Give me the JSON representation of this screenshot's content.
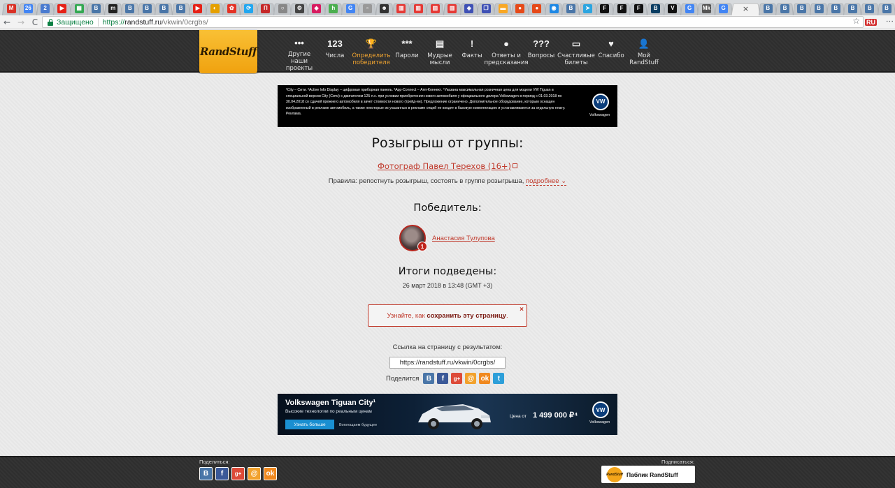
{
  "browser": {
    "tabs": [
      {
        "icon": "gmail-icon",
        "glyph": "M",
        "color": "#d93025"
      },
      {
        "icon": "calendar-icon",
        "glyph": "26",
        "color": "#4285f4"
      },
      {
        "icon": "two-icon",
        "glyph": "2",
        "color": "#4a7bd0"
      },
      {
        "icon": "youtube-icon",
        "glyph": "▶",
        "color": "#e62117"
      },
      {
        "icon": "grid-icon",
        "glyph": "▦",
        "color": "#34a853"
      },
      {
        "icon": "vk-icon",
        "glyph": "B",
        "color": "#4a76a8"
      },
      {
        "icon": "m-icon",
        "glyph": "m",
        "color": "#222"
      },
      {
        "icon": "vk-icon",
        "glyph": "B",
        "color": "#4a76a8"
      },
      {
        "icon": "vk-icon",
        "glyph": "B",
        "color": "#4a76a8"
      },
      {
        "icon": "vk-icon",
        "glyph": "B",
        "color": "#4a76a8"
      },
      {
        "icon": "vk-icon",
        "glyph": "B",
        "color": "#4a76a8"
      },
      {
        "icon": "youtube-icon",
        "glyph": "▶",
        "color": "#e62117"
      },
      {
        "icon": "weather-icon",
        "glyph": "◐",
        "color": "#e5a000"
      },
      {
        "icon": "aliexpress-icon",
        "glyph": "✿",
        "color": "#e43225"
      },
      {
        "icon": "refresh-icon",
        "glyph": "⟳",
        "color": "#22a7f0"
      },
      {
        "icon": "doc-icon",
        "glyph": "П",
        "color": "#c62828"
      },
      {
        "icon": "circle-icon",
        "glyph": "○",
        "color": "#888"
      },
      {
        "icon": "gear-icon",
        "glyph": "⚙",
        "color": "#444"
      },
      {
        "icon": "shield-icon",
        "glyph": "◆",
        "color": "#d81b60"
      },
      {
        "icon": "h-icon",
        "glyph": "h",
        "color": "#4caf50"
      },
      {
        "icon": "google-icon",
        "glyph": "G",
        "color": "#4285f4"
      },
      {
        "icon": "page-icon",
        "glyph": "▫",
        "color": "#999"
      },
      {
        "icon": "person-icon",
        "glyph": "☻",
        "color": "#333"
      },
      {
        "icon": "bars-icon",
        "glyph": "▥",
        "color": "#e53935"
      },
      {
        "icon": "bars-icon",
        "glyph": "▥",
        "color": "#e53935"
      },
      {
        "icon": "bars-icon",
        "glyph": "▥",
        "color": "#e53935"
      },
      {
        "icon": "bars-icon",
        "glyph": "▥",
        "color": "#e53935"
      },
      {
        "icon": "cube-icon",
        "glyph": "◈",
        "color": "#3f51b5"
      },
      {
        "icon": "copy-icon",
        "glyph": "❐",
        "color": "#3f51b5"
      },
      {
        "icon": "flag-icon",
        "glyph": "▬",
        "color": "#f9a825"
      },
      {
        "icon": "ball-icon",
        "glyph": "●",
        "color": "#e64a19"
      },
      {
        "icon": "ball-icon",
        "glyph": "●",
        "color": "#e64a19"
      },
      {
        "icon": "drop-icon",
        "glyph": "◉",
        "color": "#1e88e5"
      },
      {
        "icon": "vk-icon",
        "glyph": "B",
        "color": "#4a76a8"
      },
      {
        "icon": "telegram-icon",
        "glyph": "➤",
        "color": "#2ca5e0"
      },
      {
        "icon": "f-icon",
        "glyph": "F",
        "color": "#111"
      },
      {
        "icon": "f-icon",
        "glyph": "F",
        "color": "#111"
      },
      {
        "icon": "f-icon",
        "glyph": "F",
        "color": "#111"
      },
      {
        "icon": "b-icon",
        "glyph": "B",
        "color": "#0a3d62"
      },
      {
        "icon": "v-icon",
        "glyph": "V",
        "color": "#111"
      },
      {
        "icon": "google-icon",
        "glyph": "G",
        "color": "#4285f4"
      },
      {
        "icon": "mk-icon",
        "glyph": "Mk",
        "color": "#555"
      },
      {
        "icon": "google-icon",
        "glyph": "G",
        "color": "#4285f4"
      }
    ],
    "tabs_after": [
      {
        "icon": "vk-icon",
        "glyph": "B",
        "color": "#4a76a8"
      },
      {
        "icon": "vk-icon",
        "glyph": "B",
        "color": "#4a76a8"
      },
      {
        "icon": "vk-icon",
        "glyph": "B",
        "color": "#4a76a8"
      },
      {
        "icon": "vk-icon",
        "glyph": "B",
        "color": "#4a76a8"
      },
      {
        "icon": "vk-icon",
        "glyph": "B",
        "color": "#4a76a8"
      },
      {
        "icon": "vk-icon",
        "glyph": "B",
        "color": "#4a76a8"
      },
      {
        "icon": "vk-icon",
        "glyph": "B",
        "color": "#4a76a8"
      },
      {
        "icon": "vk-icon",
        "glyph": "B",
        "color": "#4a76a8"
      }
    ],
    "active_tab_close": "×",
    "back": "←",
    "forward": "→",
    "reload": "C",
    "secure_label": "Защищено",
    "url_scheme": "https://",
    "url_host": "randstuff.ru",
    "url_path": "/vkwin/0crgbs/",
    "star": "☆",
    "ext_label": "RU"
  },
  "site": {
    "logo": "RandStuff",
    "nav": [
      {
        "icon_name": "dots-icon",
        "icon": "•••",
        "label": "Другие наши проекты"
      },
      {
        "icon_name": "numbers-icon",
        "icon": "123",
        "label": "Числа"
      },
      {
        "icon_name": "trophy-icon",
        "icon": "🏆",
        "label": "Определить победителя",
        "active": true
      },
      {
        "icon_name": "password-icon",
        "icon": "***",
        "label": "Пароли"
      },
      {
        "icon_name": "notebook-icon",
        "icon": "▤",
        "label": "Мудрые мысли"
      },
      {
        "icon_name": "warning-icon",
        "icon": "!",
        "label": "Факты"
      },
      {
        "icon_name": "ball8-icon",
        "icon": "●",
        "label": "Ответы и предсказания"
      },
      {
        "icon_name": "questions-icon",
        "icon": "???",
        "label": "Вопросы"
      },
      {
        "icon_name": "ticket-icon",
        "icon": "▭",
        "label": "Счастливые билеты"
      },
      {
        "icon_name": "heart-icon",
        "icon": "♥",
        "label": "Спасибо"
      },
      {
        "icon_name": "user-icon",
        "icon": "👤",
        "label": "Мой RandStuff"
      }
    ],
    "active_color": "#f3a630"
  },
  "ad_top": {
    "text": "¹City – Сити. ²Active Info Display – цифровая приборная панель. ³App-Connect – Апп-Коннект. ⁴Указана максимальная розничная цена для модели VW Tiguan в специальной версии City (Сити) с двигателем 125 л.с. при условии приобретения нового автомобиля у официального дилера Volkswagen в период с 01.03.2018 по 30.04.2018 со сдачей прежнего автомобиля в зачет стоимости нового (трейд-ин). Предложение ограничено. Дополнительное оборудование, которым оснащен изображенный в рекламе автомобиль, а также некоторые из указанных в рекламе опций не входят в базовую комплектацию и устанавливаются за отдельную плату. Реклама.",
    "brand": "Volkswagen",
    "logo": "VW"
  },
  "page": {
    "title": "Розыгрыш от группы:",
    "group_link": "Фотограф Павел Терехов (16+)",
    "rules_prefix": "Правила: репостнуть розыгрыш, состоять в группе розыгрыша,",
    "rules_more": "подробнее",
    "winner_heading": "Победитель:",
    "winner_name": "Анастасия Тулупова",
    "winner_badge": "1",
    "results_heading": "Итоги подведены:",
    "results_date": "26 март 2018 в 13:48 (GMT +3)",
    "notice_prefix": "Узнайте, как",
    "notice_bold": "сохранить эту страницу",
    "notice_suffix": ".",
    "notice_close": "×",
    "link_label": "Ссылка на страницу с результатом:",
    "link_value": "https://randstuff.ru/vkwin/0crgbs/",
    "share_label": "Поделится",
    "share_icons": [
      {
        "name": "vk-share-icon",
        "glyph": "B",
        "cls": "vk"
      },
      {
        "name": "facebook-share-icon",
        "glyph": "f",
        "cls": "fb"
      },
      {
        "name": "googleplus-share-icon",
        "glyph": "g+",
        "cls": "gp"
      },
      {
        "name": "mailru-share-icon",
        "glyph": "@",
        "cls": "mr"
      },
      {
        "name": "odnoklassniki-share-icon",
        "glyph": "ok",
        "cls": "ok"
      },
      {
        "name": "twitter-share-icon",
        "glyph": "t",
        "cls": "tw"
      }
    ]
  },
  "ad_bottom": {
    "title": "Volkswagen Tiguan City¹",
    "subtitle": "Высокие технологии по реальным ценам",
    "button": "Узнать больше",
    "slogan": "Воплощаем будущее",
    "price_label": "Цена от",
    "price": "1 499 000 ₽⁴",
    "brand": "Volkswagen",
    "logo": "VW"
  },
  "footer": {
    "share_label": "Поделиться:",
    "share_icons": [
      {
        "name": "vk-footer-icon",
        "glyph": "B",
        "cls": "vk"
      },
      {
        "name": "facebook-footer-icon",
        "glyph": "f",
        "cls": "fb"
      },
      {
        "name": "googleplus-footer-icon",
        "glyph": "g+",
        "cls": "gp"
      },
      {
        "name": "mailru-footer-icon",
        "glyph": "@",
        "cls": "mr"
      },
      {
        "name": "odnoklassniki-footer-icon",
        "glyph": "ok",
        "cls": "ok"
      }
    ],
    "subscribe_label": "Подписаться:",
    "public_button": "Паблик RandStuff",
    "public_logo": "RandStuff"
  }
}
